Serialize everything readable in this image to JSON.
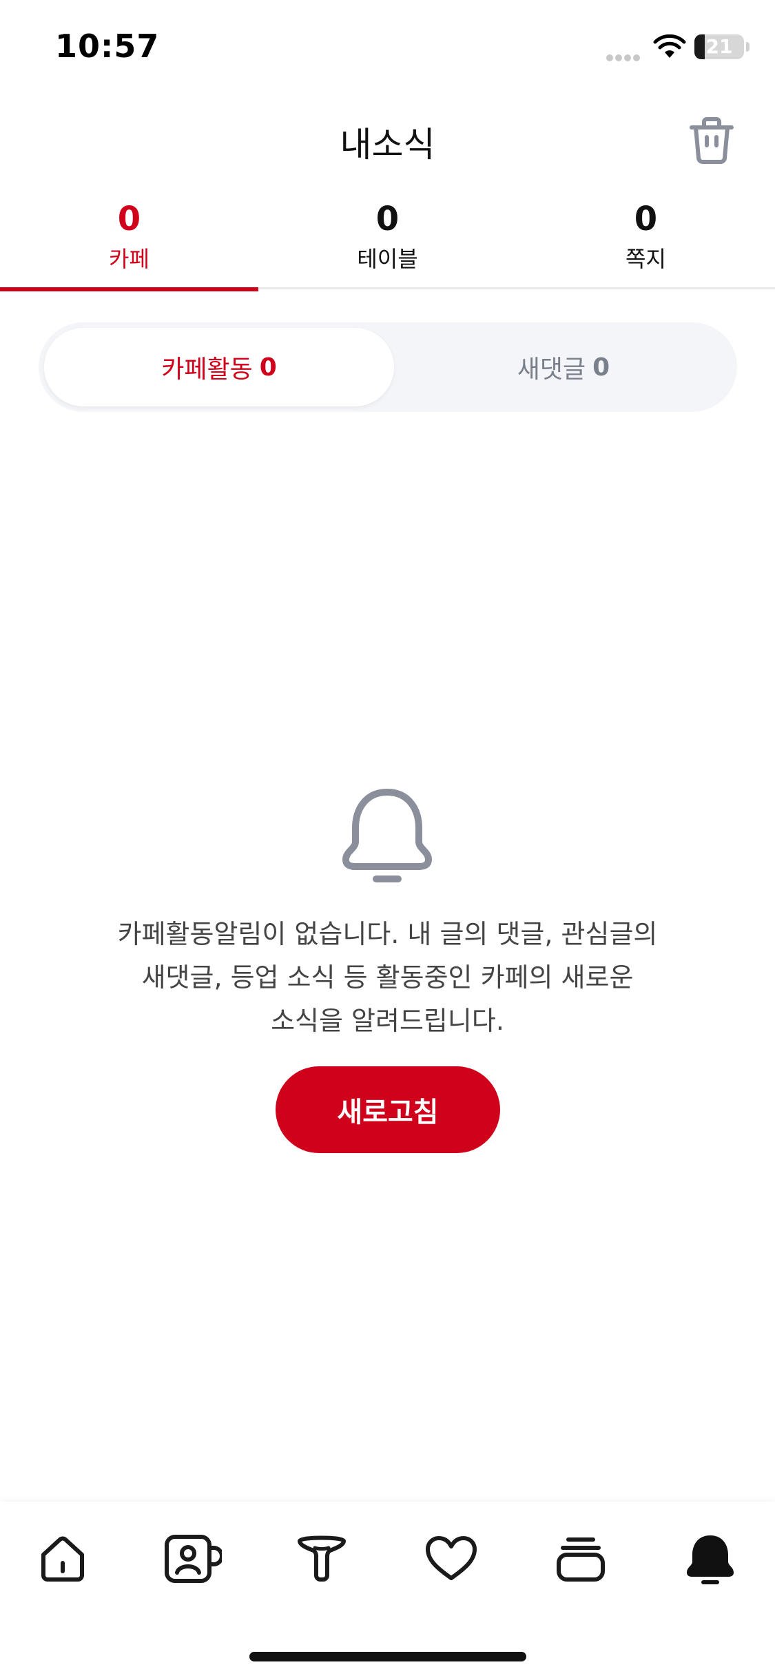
{
  "status_bar": {
    "time": "10:57",
    "battery": "21",
    "battery_level_percent": 21
  },
  "header": {
    "title": "내소식"
  },
  "top_tabs": [
    {
      "count": "0",
      "label": "카페",
      "active": true
    },
    {
      "count": "0",
      "label": "테이블",
      "active": false
    },
    {
      "count": "0",
      "label": "쪽지",
      "active": false
    }
  ],
  "segments": [
    {
      "label": "카페활동",
      "count": "0",
      "active": true
    },
    {
      "label": "새댓글",
      "count": "0",
      "active": false
    }
  ],
  "empty_state": {
    "message_line1": "카페활동알림이 없습니다. 내 글의 댓글, 관심글의",
    "message_line2": "새댓글, 등업 소식 등 활동중인 카페의 새로운",
    "message_line3": "소식을 알려드립니다.",
    "refresh_label": "새로고침"
  },
  "bottom_nav": [
    {
      "icon": "home-icon"
    },
    {
      "icon": "cafe-profile-icon"
    },
    {
      "icon": "table-icon"
    },
    {
      "icon": "heart-icon"
    },
    {
      "icon": "stack-icon"
    },
    {
      "icon": "bell-filled-icon"
    }
  ],
  "colors": {
    "accent": "#d0021b",
    "muted": "#7a7f8c",
    "icon_gray": "#8a8f9b"
  }
}
